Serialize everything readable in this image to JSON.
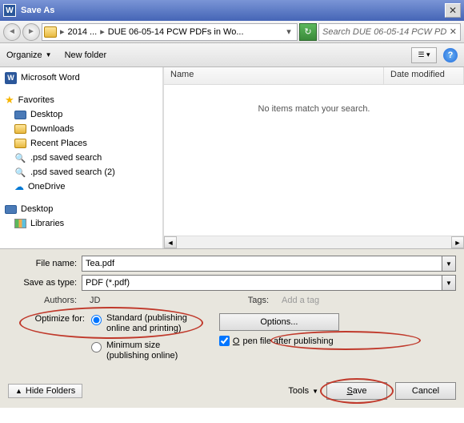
{
  "titlebar": {
    "title": "Save As"
  },
  "nav": {
    "crumb1": "2014 ...",
    "crumb2": "DUE 06-05-14 PCW PDFs in Wo...",
    "search_value": "Search DUE 06-05-14 PCW PD..."
  },
  "toolbar": {
    "organize": "Organize",
    "new_folder": "New folder",
    "help": "?"
  },
  "sidebar": {
    "items": [
      {
        "label": "Microsoft Word",
        "icon": "word",
        "lvl": 0
      },
      {
        "label": "Favorites",
        "icon": "star",
        "lvl": 0,
        "spacer_before": true
      },
      {
        "label": "Desktop",
        "icon": "desktop",
        "lvl": 1
      },
      {
        "label": "Downloads",
        "icon": "folder",
        "lvl": 1
      },
      {
        "label": "Recent Places",
        "icon": "folder",
        "lvl": 1
      },
      {
        "label": ".psd saved search",
        "icon": "search",
        "lvl": 1
      },
      {
        "label": ".psd saved search (2)",
        "icon": "search",
        "lvl": 1
      },
      {
        "label": "OneDrive",
        "icon": "cloud",
        "lvl": 1
      },
      {
        "label": "Desktop",
        "icon": "desktop",
        "lvl": 0,
        "spacer_before": true
      },
      {
        "label": "Libraries",
        "icon": "lib",
        "lvl": 1
      }
    ]
  },
  "filelist": {
    "col_name": "Name",
    "col_date": "Date modified",
    "empty_msg": "No items match your search."
  },
  "form": {
    "filename_label": "File name:",
    "filename_value": "Tea.pdf",
    "savetype_label": "Save as type:",
    "savetype_value": "PDF (*.pdf)",
    "authors_label": "Authors:",
    "authors_value": "JD",
    "tags_label": "Tags:",
    "tags_placeholder": "Add a tag",
    "optimize_label": "Optimize for:",
    "radio_standard": "Standard (publishing\nonline and printing)",
    "radio_standard_l1": "Standard (publishing",
    "radio_standard_l2": "online and printing)",
    "radio_minimum_l1": "Minimum size",
    "radio_minimum_l2": "(publishing online)",
    "options_btn": "Options...",
    "open_after": "Open file after publishing"
  },
  "footer": {
    "hide_folders": "Hide Folders",
    "tools": "Tools",
    "save": "Save",
    "cancel": "Cancel"
  }
}
